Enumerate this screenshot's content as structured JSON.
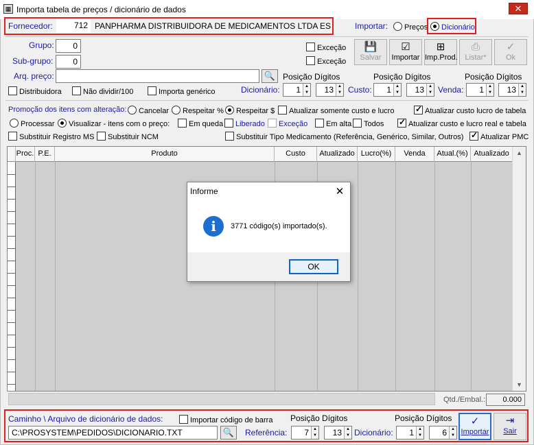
{
  "window": {
    "title": "Importa tabela de preços / dicionário de dados",
    "close": "✕"
  },
  "fornecedor": {
    "label": "Fornecedor:",
    "code": "712",
    "name": "PANPHARMA DISTRIBUIDORA DE MEDICAMENTOS LTDA ES"
  },
  "importar": {
    "label": "Importar:",
    "precos": "Preços",
    "dicionario": "Dicionário",
    "selected": "dicionario"
  },
  "grupo": {
    "label": "Grupo:",
    "value": "0",
    "excecao": "Exceção"
  },
  "subgrupo": {
    "label": "Sub-grupo:",
    "value": "0",
    "excecao": "Exceção"
  },
  "arq_preco": {
    "label": "Arq. preço:",
    "value": ""
  },
  "toolbar": {
    "salvar": "Salvar",
    "importar": "Importar",
    "imp_prod": "Imp.Prod.",
    "listar": "Listar*",
    "ok": "Ok"
  },
  "options_row": {
    "distribuidora": "Distribuidora",
    "nao_dividir": "Não dividir/100",
    "importa_generico": "Importa genérico"
  },
  "posicao": {
    "header": "Posição Dígitos",
    "dicionario_label": "Dicionário:",
    "dic_pos": "1",
    "dic_dig": "13",
    "custo_label": "Custo:",
    "custo_pos": "1",
    "custo_dig": "13",
    "venda_label": "Venda:",
    "venda_pos": "1",
    "venda_dig": "13"
  },
  "promocao": {
    "label": "Promoção dos itens com alteração:",
    "cancelar": "Cancelar",
    "respeitar_pct": "Respeitar %",
    "respeitar_cur": "Respeitar $",
    "atualizar_custo_lucro": "Atualizar somente custo e lucro",
    "atualizar_custo_lucro_tabela": "Atualizar custo lucro de tabela"
  },
  "processar": {
    "processar": "Processar",
    "visualizar": "Visualizar - itens com o preço:",
    "em_queda": "Em queda",
    "liberado": "Liberado",
    "excecao": "Exceção",
    "em_alta": "Em alta",
    "todos": "Todos",
    "atualizar_real": "Atualizar custo e lucro real e tabela"
  },
  "substituir": {
    "registro_ms": "Substituir Registro MS",
    "ncm": "Substituir NCM",
    "tipo_medicamento": "Substituir Tipo Medicamento (Referência, Genérico, Similar, Outros)",
    "atualizar_pmc": "Atualizar PMC"
  },
  "grid": {
    "columns": [
      "Proc.",
      "P.E.",
      "Produto",
      "Custo",
      "Atualizado",
      "Lucro(%)",
      "Venda",
      "Atual.(%)",
      "Atualizado"
    ]
  },
  "qtd_embal": {
    "label": "Qtd./Embal.:",
    "value": "0.000"
  },
  "caminho": {
    "label": "Caminho \\ Arquivo de dicionário de dados:",
    "path": "C:\\PROSYSTEM\\PEDIDOS\\DICIONARIO.TXT",
    "importar_barra": "Importar código de barra",
    "header": "Posição Dígitos",
    "referencia_label": "Referência:",
    "ref_pos": "7",
    "ref_dig": "13",
    "dicionario_label": "Dicionário:",
    "dic_pos": "1",
    "dic_dig": "6",
    "importar_btn": "Importar",
    "sair_btn": "Sair"
  },
  "dialog": {
    "title": "Informe",
    "close": "✕",
    "message": "3771 código(s) importado(s).",
    "ok": "OK",
    "icon": "info-icon"
  }
}
